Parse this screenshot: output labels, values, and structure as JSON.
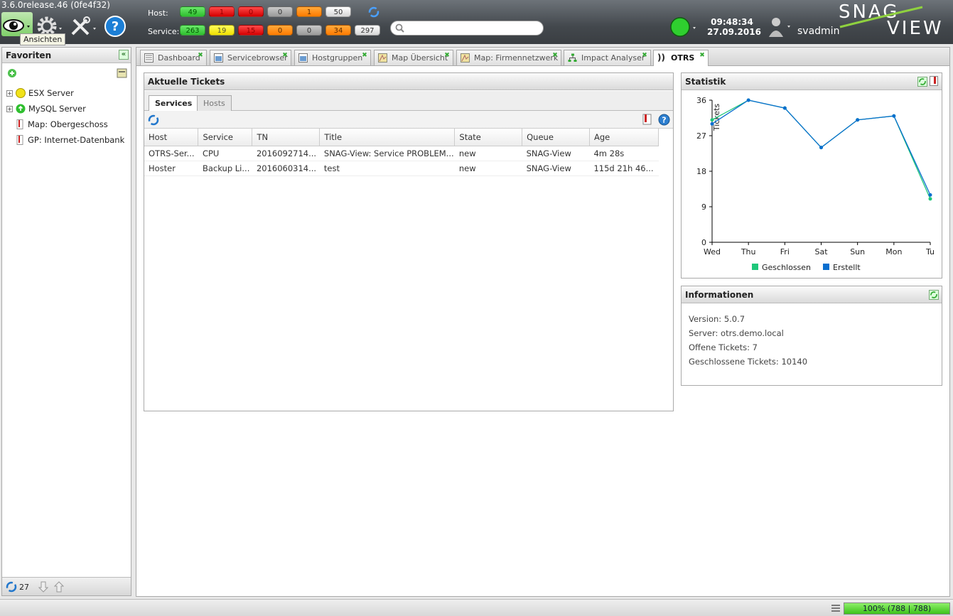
{
  "app": {
    "version": "3.6.0release.46 (0fe4f32)",
    "tooltip": "Ansichten",
    "brand_line1": "SNAG",
    "brand_line2": "VIEW"
  },
  "status": {
    "host_label": "Host:",
    "service_label": "Service:",
    "host_counts": [
      "49",
      "1",
      "0",
      "0",
      "1",
      "50"
    ],
    "service_counts": [
      "263",
      "19",
      "15",
      "0",
      "0",
      "34",
      "297"
    ]
  },
  "search": {
    "placeholder": ""
  },
  "clock": {
    "time": "09:48:34",
    "date": "27.09.2016"
  },
  "user": {
    "name": "svadmin"
  },
  "favorites": {
    "title": "Favoriten",
    "items": [
      {
        "label": "ESX Server"
      },
      {
        "label": "MySQL Server"
      },
      {
        "label": "Map: Obergeschoss"
      },
      {
        "label": "GP: Internet-Datenbank"
      }
    ],
    "footer_count": "27"
  },
  "tabs": [
    {
      "label": "Dashboard"
    },
    {
      "label": "Servicebrowser"
    },
    {
      "label": "Hostgruppen"
    },
    {
      "label": "Map Übersicht"
    },
    {
      "label": "Map: Firmennetzwerk"
    },
    {
      "label": "Impact Analyser"
    },
    {
      "label": "OTRS"
    }
  ],
  "tickets": {
    "title": "Aktuelle Tickets",
    "subtabs": [
      "Services",
      "Hosts"
    ],
    "columns": [
      "Host",
      "Service",
      "TN",
      "Title",
      "State",
      "Queue",
      "Age"
    ],
    "rows": [
      [
        "OTRS-Ser...",
        "CPU",
        "2016092714...",
        "SNAG-View: Service PROBLEM...",
        "new",
        "SNAG-View",
        "4m 28s"
      ],
      [
        "Hoster",
        "Backup Li...",
        "2016060314...",
        "test",
        "new",
        "SNAG-View",
        "115d 21h 46..."
      ]
    ]
  },
  "statistik": {
    "title": "Statistik"
  },
  "chart_data": {
    "type": "line",
    "categories": [
      "Wed",
      "Thu",
      "Fri",
      "Sat",
      "Sun",
      "Mon",
      "Tu"
    ],
    "ylabel": "Tickets",
    "ylim": [
      0,
      36
    ],
    "yticks": [
      "0",
      "9",
      "18",
      "27",
      "36"
    ],
    "series": [
      {
        "name": "Geschlossen",
        "color": "#1fc77a",
        "values": [
          31,
          36,
          34,
          24,
          31,
          32,
          11
        ]
      },
      {
        "name": "Erstellt",
        "color": "#0a6fcf",
        "values": [
          30,
          36,
          34,
          24,
          31,
          32,
          12
        ]
      }
    ],
    "grid": false
  },
  "informationen": {
    "title": "Informationen",
    "lines": [
      "Version: 5.0.7",
      "Server: otrs.demo.local",
      "Offene Tickets: 7",
      "Geschlossene Tickets: 10140"
    ]
  },
  "statusbar": {
    "progress": "100% (788 | 788)"
  }
}
